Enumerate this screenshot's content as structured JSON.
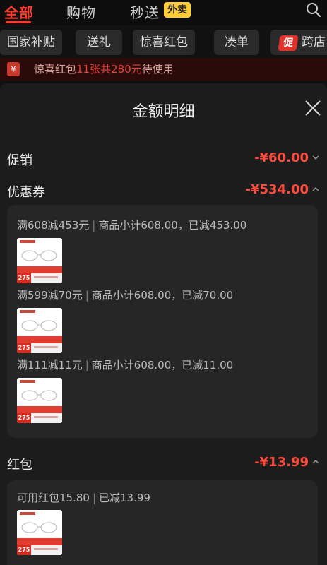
{
  "topbar": {
    "tabs": [
      {
        "label": "全部",
        "active": true
      },
      {
        "label": "购物",
        "active": false
      },
      {
        "label": "秒送",
        "active": false
      }
    ],
    "waimai_badge": "外卖",
    "search_icon": "search-icon"
  },
  "chips": [
    "国家补贴",
    "送礼",
    "惊喜红包",
    "凑单"
  ],
  "promo_chip": {
    "tag": "促",
    "label": "跨店"
  },
  "banner": {
    "icon": "yen-icon",
    "prefix": "惊喜红包",
    "highlight": "11张共280元",
    "suffix": "待使用"
  },
  "modal": {
    "title": "金额明细",
    "close_icon": "close-icon",
    "promotion": {
      "label": "促销",
      "amount": "-¥60.00"
    },
    "coupon": {
      "label": "优惠券",
      "amount": "-¥534.00",
      "items": [
        {
          "rule": "满608减453元",
          "detail": "商品小计608.00，已减453.00",
          "thumb_price": "275"
        },
        {
          "rule": "满599减70元",
          "detail": "商品小计608.00，已减70.00",
          "thumb_price": "275"
        },
        {
          "rule": "满111减11元",
          "detail": "商品小计608.00，已减11.00",
          "thumb_price": "275"
        }
      ]
    },
    "redpacket": {
      "label": "红包",
      "amount": "-¥13.99",
      "available": "可用红包15.80",
      "reduced": "已减13.99",
      "thumb_price": "275"
    }
  },
  "colors": {
    "accent": "#ff3b2f",
    "amount": "#ff4a3d",
    "background": "#111111",
    "card": "#262626"
  }
}
